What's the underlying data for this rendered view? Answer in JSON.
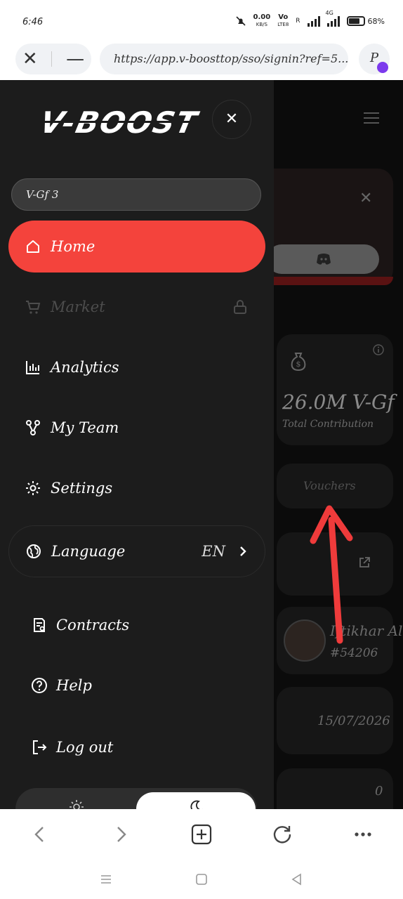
{
  "status_bar": {
    "time": "6:46",
    "net_speed": "0.00",
    "net_unit": "KB/S",
    "lte_top": "Vo",
    "lte_bottom": "LTE8",
    "roaming": "R",
    "network_4g": "4G",
    "battery": "68%"
  },
  "browser": {
    "url": "https://app.v-boosttop/sso/signin?ref=5...",
    "extension_label": "P"
  },
  "drawer": {
    "logo": "V-BOOST",
    "user_name": "V-Gf 3",
    "nav": {
      "home": "Home",
      "market": "Market",
      "analytics": "Analytics",
      "my_team": "My Team",
      "settings": "Settings",
      "language": "Language",
      "language_value": "EN"
    },
    "secondary": {
      "contracts": "Contracts",
      "help": "Help",
      "logout": "Log out"
    }
  },
  "background_page": {
    "total_amount": "26.0M V-Gf",
    "total_label": "Total Contribution",
    "vouchers": "Vouchers",
    "member_name": "Iftikhar Al",
    "member_id": "#54206",
    "date": "15/07/2026",
    "count": "0"
  },
  "colors": {
    "accent": "#f4433c",
    "drawer_bg": "#1c1c1c",
    "annotation_arrow": "#ef3b3b",
    "extension_dot": "#7c3aed"
  }
}
